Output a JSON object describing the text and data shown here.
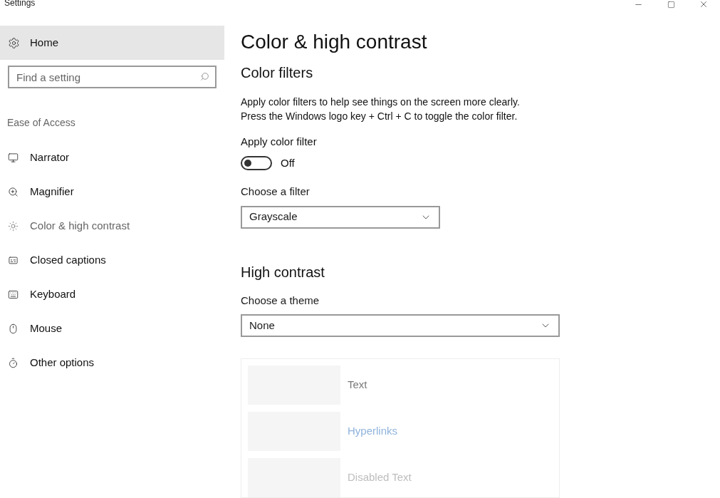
{
  "window": {
    "title": "Settings"
  },
  "sidebar": {
    "home": "Home",
    "search": {
      "placeholder": "Find a setting"
    },
    "section": "Ease of Access",
    "items": [
      {
        "label": "Narrator",
        "selected": false
      },
      {
        "label": "Magnifier",
        "selected": false
      },
      {
        "label": "Color & high contrast",
        "selected": true
      },
      {
        "label": "Closed captions",
        "selected": false
      },
      {
        "label": "Keyboard",
        "selected": false
      },
      {
        "label": "Mouse",
        "selected": false
      },
      {
        "label": "Other options",
        "selected": false
      }
    ]
  },
  "page": {
    "title": "Color & high contrast",
    "color_filters": {
      "heading": "Color filters",
      "description": [
        "Apply color filters to help see things on the screen more clearly.",
        "Press the Windows logo key + Ctrl + C to toggle the color filter."
      ],
      "toggle": {
        "label": "Apply color filter",
        "on": false,
        "state_text": "Off"
      },
      "filter": {
        "label": "Choose a filter",
        "value": "Grayscale"
      }
    },
    "high_contrast": {
      "heading": "High contrast",
      "theme": {
        "label": "Choose a theme",
        "value": "None"
      },
      "preview": [
        {
          "kind": "text",
          "label": "Text"
        },
        {
          "kind": "link",
          "label": "Hyperlinks"
        },
        {
          "kind": "disabled",
          "label": "Disabled Text"
        }
      ]
    }
  }
}
